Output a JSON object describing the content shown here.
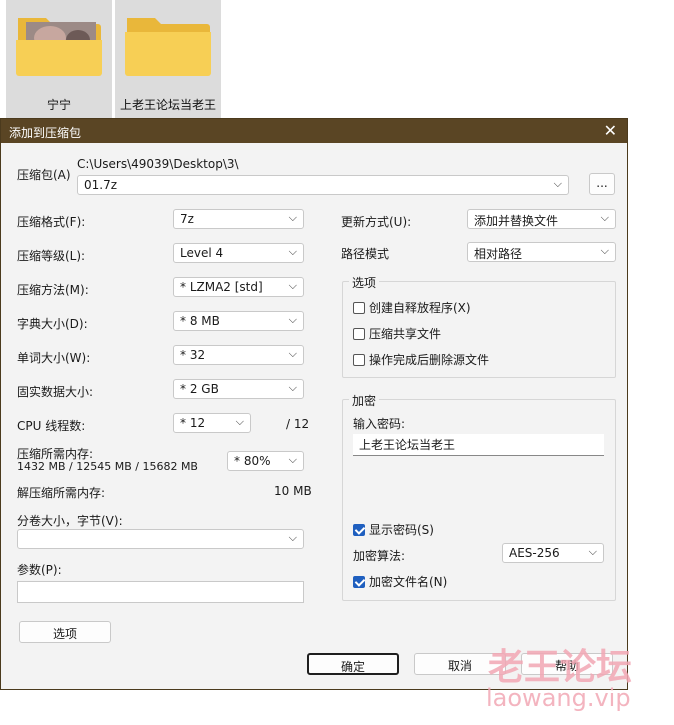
{
  "desktop": {
    "icons": [
      {
        "label": "宁宁",
        "type": "folder-with-photo"
      },
      {
        "label": "上老王论坛当老王",
        "type": "folder"
      }
    ]
  },
  "dialog": {
    "title": "添加到压缩包",
    "close_glyph": "✕",
    "archive_label": "压缩包(A)",
    "archive_path": "C:\\Users\\49039\\Desktop\\3\\",
    "archive_name": "01.7z",
    "browse_label": "...",
    "left": {
      "format": {
        "label": "压缩格式(F):",
        "value": "7z"
      },
      "level": {
        "label": "压缩等级(L):",
        "value": "Level 4"
      },
      "method": {
        "label": "压缩方法(M):",
        "value": "*  LZMA2 [std]"
      },
      "dict": {
        "label": "字典大小(D):",
        "value": "*  8 MB"
      },
      "word": {
        "label": "单词大小(W):",
        "value": "*  32"
      },
      "solid": {
        "label": "固实数据大小:",
        "value": "*  2 GB"
      },
      "threads": {
        "label": "CPU 线程数:",
        "value": "*  12",
        "suffix": "/ 12"
      },
      "mem_compress": {
        "label": "压缩所需内存:",
        "detail": "1432 MB / 12545 MB / 15682 MB",
        "value": "* 80%"
      },
      "mem_decompress": {
        "label": "解压缩所需内存:",
        "value": "10 MB"
      },
      "split": {
        "label": "分卷大小，字节(V):",
        "value": ""
      },
      "params": {
        "label": "参数(P):",
        "value": ""
      },
      "options_button": "选项"
    },
    "right": {
      "update": {
        "label": "更新方式(U):",
        "value": "添加并替换文件"
      },
      "path_mode": {
        "label": "路径模式",
        "value": "相对路径"
      },
      "options_group": {
        "title": "选项",
        "items": [
          {
            "label": "创建自释放程序(X)",
            "checked": false
          },
          {
            "label": "压缩共享文件",
            "checked": false
          },
          {
            "label": "操作完成后删除源文件",
            "checked": false
          }
        ]
      },
      "encryption": {
        "title": "加密",
        "password_label": "输入密码:",
        "password_value": "上老王论坛当老王",
        "show_password": {
          "label": "显示密码(S)",
          "checked": true
        },
        "method_label": "加密算法:",
        "method_value": "AES-256",
        "encrypt_names": {
          "label": "加密文件名(N)",
          "checked": true
        }
      }
    },
    "buttons": {
      "ok": "确定",
      "cancel": "取消",
      "help": "帮助"
    }
  },
  "watermark": {
    "text": "老王论坛",
    "domain": "laowang.vip"
  },
  "colors": {
    "titlebar": "#5a4524",
    "check": "#1f5fbf",
    "watermark": "#f2a7b4"
  }
}
